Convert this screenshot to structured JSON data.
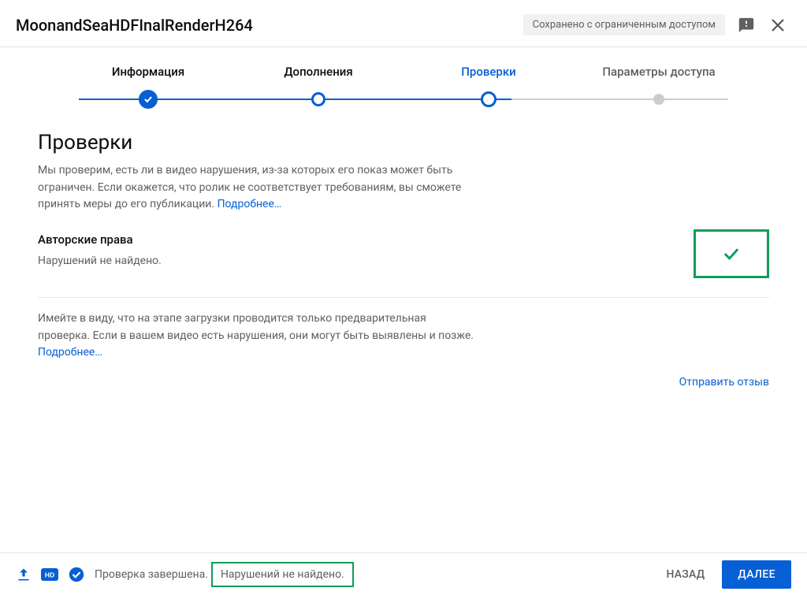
{
  "header": {
    "title": "MoonandSeaHDFInalRenderH264",
    "save_status": "Сохранено с ограниченным доступом"
  },
  "stepper": {
    "steps": [
      {
        "label": "Информация",
        "state": "done"
      },
      {
        "label": "Дополнения",
        "state": "done"
      },
      {
        "label": "Проверки",
        "state": "active"
      },
      {
        "label": "Параметры доступа",
        "state": "future"
      }
    ]
  },
  "page": {
    "heading": "Проверки",
    "description": "Мы проверим, есть ли в видео нарушения, из-за которых его показ может быть ограничен. Если окажется, что ролик не соответствует требованиям, вы сможете принять меры до его публикации. ",
    "learn_more": "Подробнее…",
    "copyright": {
      "title": "Авторские права",
      "status": "Нарушений не найдено."
    },
    "note": "Имейте в виду, что на этапе загрузки проводится только предварительная проверка. Если в вашем видео есть нарушения, они могут быть выявлены и позже. ",
    "note_learn_more": "Подробнее…",
    "send_feedback": "Отправить отзыв"
  },
  "bottombar": {
    "status_prefix": "Проверка завершена.",
    "status_result": "Нарушений не найдено.",
    "back": "НАЗАД",
    "next": "ДАЛЕЕ"
  }
}
